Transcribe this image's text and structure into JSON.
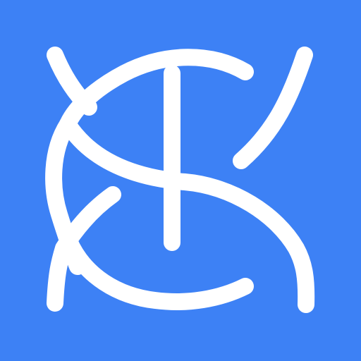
{
  "icon": {
    "name": "kts-monogram-app-icon",
    "background_color": "#3D81F5",
    "glyph_color": "#FFFFFF"
  }
}
